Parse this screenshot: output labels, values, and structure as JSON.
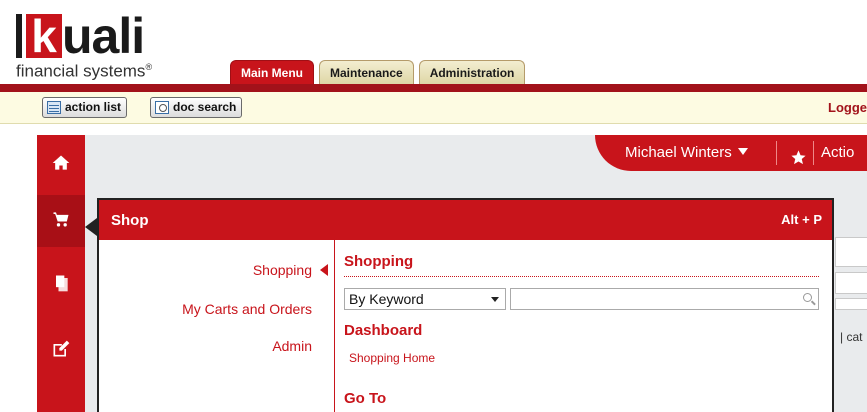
{
  "header": {
    "logo_letter": "k",
    "logo_word": "uali",
    "logo_sub": "financial systems",
    "logo_mark": "®",
    "tabs": [
      {
        "label": "Main Menu",
        "active": true
      },
      {
        "label": "Maintenance",
        "active": false
      },
      {
        "label": "Administration",
        "active": false
      }
    ]
  },
  "toolbar": {
    "action_list": "action list",
    "doc_search": "doc search",
    "logged_text": "Logge"
  },
  "user": {
    "name": "Michael Winters",
    "action_partial": "Actio"
  },
  "leftnav": {
    "icons": [
      "home-icon",
      "cart-icon",
      "documents-icon",
      "edit-icon"
    ]
  },
  "panel": {
    "title": "Shop",
    "shortcut": "Alt + P",
    "left_links": [
      "Shopping",
      "My Carts and Orders",
      "Admin"
    ],
    "shopping_title": "Shopping",
    "search_mode": "By Keyword",
    "search_value": "",
    "dashboard_title": "Dashboard",
    "dashboard_link": "Shopping Home",
    "goto_title": "Go To"
  },
  "side": {
    "partial_text": "| cat"
  },
  "colors": {
    "brand_red": "#c8141b",
    "dark_red": "#a2121a",
    "toolbar_bg": "#fdfbe2",
    "content_bg": "#e9ebed"
  }
}
